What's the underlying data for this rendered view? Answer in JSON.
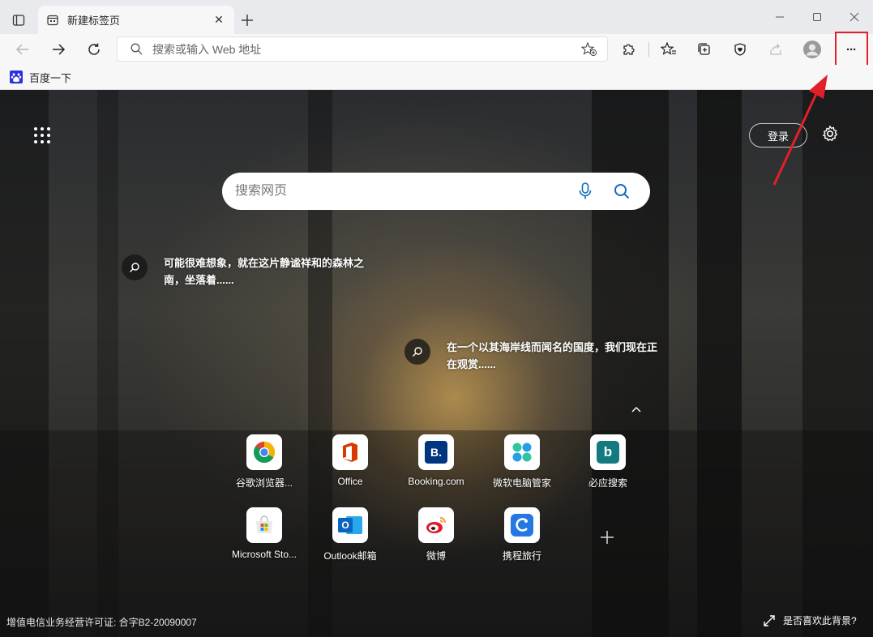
{
  "tab": {
    "title": "新建标签页",
    "close_glyph": "✕"
  },
  "new_tab_glyph": "+",
  "address_bar": {
    "placeholder": "搜索或输入 Web 地址"
  },
  "more_glyph": "···",
  "favorites": [
    {
      "label": "百度一下",
      "icon": "baidu-paw-icon"
    }
  ],
  "newtab": {
    "login_label": "登录",
    "search_placeholder": "搜索网页",
    "hotspots": [
      {
        "text": "可能很难想象，就在这片静谧祥和的森林之南，坐落着......"
      },
      {
        "text": "在一个以其海岸线而闻名的国度，我们现在正在观赏......"
      }
    ],
    "tiles": [
      {
        "label": "谷歌浏览器...",
        "icon": "chrome-icon"
      },
      {
        "label": "Office",
        "icon": "office-icon"
      },
      {
        "label": "Booking.com",
        "icon": "booking-icon",
        "glyph": "B."
      },
      {
        "label": "微软电脑管家",
        "icon": "pc-manager-icon"
      },
      {
        "label": "必应搜索",
        "icon": "bing-icon",
        "glyph": "b"
      },
      {
        "label": "Microsoft Sto...",
        "icon": "ms-store-icon"
      },
      {
        "label": "Outlook邮箱",
        "icon": "outlook-icon",
        "glyph": "O"
      },
      {
        "label": "微博",
        "icon": "weibo-icon"
      },
      {
        "label": "携程旅行",
        "icon": "ctrip-icon"
      }
    ],
    "add_glyph": "+",
    "footer_license": "增值电信业务经营许可证: 合字B2-20090007",
    "footer_feedback": "是否喜欢此背景?"
  },
  "colors": {
    "annotation_red": "#e1202a",
    "bing_teal": "#137a7f",
    "booking_blue": "#003580",
    "outlook_blue": "#0a64c2"
  }
}
